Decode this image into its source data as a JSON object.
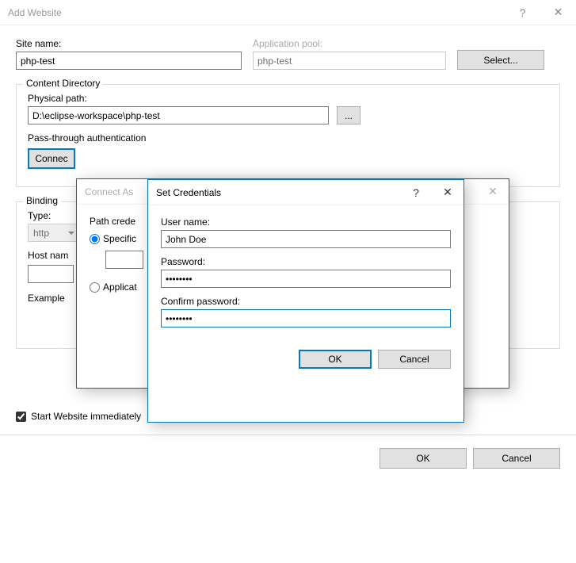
{
  "window": {
    "title": "Add Website"
  },
  "site": {
    "name_label": "Site name:",
    "name_value": "php-test",
    "pool_label": "Application pool:",
    "pool_value": "php-test",
    "select_btn": "Select..."
  },
  "content_dir": {
    "title": "Content Directory",
    "path_label": "Physical path:",
    "path_value": "D:\\eclipse-workspace\\php-test",
    "browse_btn": "...",
    "passthrough_label": "Pass-through authentication",
    "connect_btn": "Connec"
  },
  "binding": {
    "title": "Binding",
    "type_label": "Type:",
    "type_value": "http",
    "host_label": "Host nam",
    "example_label": "Example"
  },
  "connect_as": {
    "title": "Connect As",
    "path_creds_label": "Path crede",
    "specific_label": "Specific",
    "appuser_label": "Applicat"
  },
  "credentials": {
    "title": "Set Credentials",
    "username_label": "User name:",
    "username_value": "John Doe",
    "password_label": "Password:",
    "password_value": "••••••••",
    "confirm_label": "Confirm password:",
    "confirm_value": "••••••••",
    "ok": "OK",
    "cancel": "Cancel"
  },
  "footer": {
    "start_immediately": "Start Website immediately",
    "ok": "OK",
    "cancel": "Cancel"
  },
  "glyphs": {
    "help": "?",
    "close": "✕"
  }
}
